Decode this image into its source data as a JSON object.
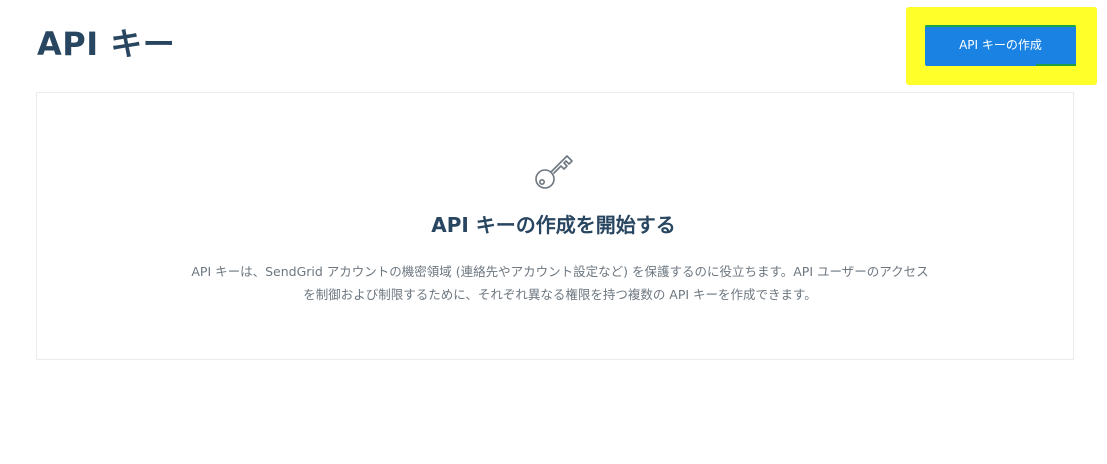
{
  "header": {
    "title": "API キー",
    "create_button_label": "API キーの作成"
  },
  "empty_state": {
    "icon": "key-icon",
    "title": "API キーの作成を開始する",
    "description": "API キーは、SendGrid アカウントの機密領域 (連絡先やアカウント設定など) を保護するのに役立ちます。API ユーザーのアクセスを制御および制限するために、それぞれ異なる権限を持つ複数の API キーを作成できます。"
  },
  "colors": {
    "title": "#294661",
    "button": "#1a82e2",
    "highlight": "#ffff2a",
    "description": "#6d7780"
  }
}
